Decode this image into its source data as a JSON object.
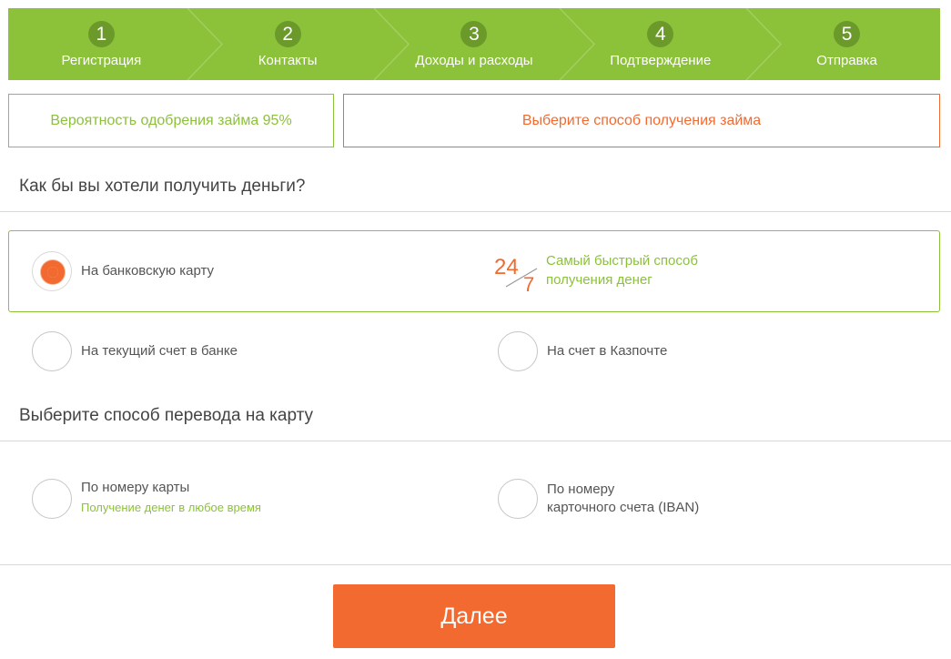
{
  "stepper": {
    "steps": [
      {
        "number": "1",
        "label": "Регистрация"
      },
      {
        "number": "2",
        "label": "Контакты"
      },
      {
        "number": "3",
        "label": "Доходы и расходы"
      },
      {
        "number": "4",
        "label": "Подтверждение"
      },
      {
        "number": "5",
        "label": "Отправка"
      }
    ],
    "colors": {
      "bar": "#8cc13a",
      "circle": "#6b9a2b"
    }
  },
  "info": {
    "approval": "Вероятность одобрения займа 95%",
    "choose_method": "Выберите способ получения займа"
  },
  "receive": {
    "title": "Как бы вы хотели получить деньги?",
    "options": [
      {
        "label": "На банковскую карту",
        "selected": true
      },
      {
        "label": "На текущий счет в банке",
        "selected": false
      },
      {
        "label": "На счет в Казпочте",
        "selected": false
      }
    ],
    "badge": {
      "icon": "24-7-icon",
      "text_line1": "Самый быстрый способ",
      "text_line2": "получения денег"
    }
  },
  "transfer": {
    "title": "Выберите способ перевода на карту",
    "options": [
      {
        "label": "По номеру карты",
        "sub": "Получение денег в любое время",
        "selected": false
      },
      {
        "label_line1": "По номеру",
        "label_line2": "карточного счета (IBAN)",
        "selected": false
      }
    ]
  },
  "actions": {
    "next_label": "Далее"
  },
  "colors": {
    "accent_green": "#8cc13a",
    "accent_orange": "#f26a30"
  }
}
